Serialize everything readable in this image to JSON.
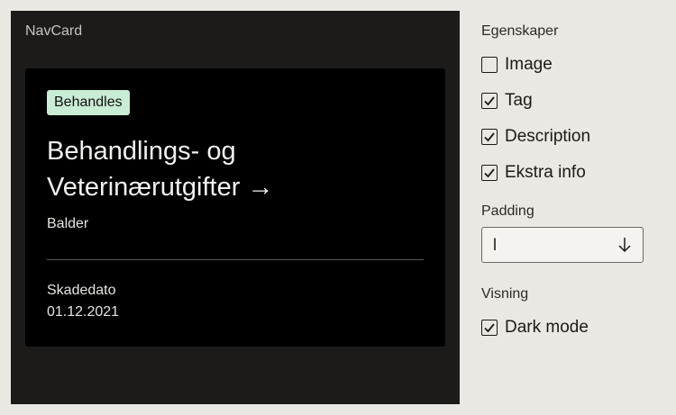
{
  "preview": {
    "label": "NavCard",
    "card": {
      "tag": "Behandles",
      "title_line1": "Behandlings- og",
      "title_line2": "Veterinærutgifter →",
      "description": "Balder",
      "extra_label": "Skadedato",
      "extra_value": "01.12.2021"
    }
  },
  "panel": {
    "properties_title": "Egenskaper",
    "checkboxes": [
      {
        "label": "Image",
        "checked": false
      },
      {
        "label": "Tag",
        "checked": true
      },
      {
        "label": "Description",
        "checked": true
      },
      {
        "label": "Ekstra info",
        "checked": true
      }
    ],
    "padding_title": "Padding",
    "padding_select": {
      "value": "l",
      "icon": "arrow-down-icon"
    },
    "view_title": "Visning",
    "dark_mode": {
      "label": "Dark mode",
      "checked": true
    }
  },
  "colors": {
    "page_bg": "#ebe8e3",
    "preview_bg": "#1c1b1a",
    "card_bg": "#000000",
    "tag_bg": "#c9ecd4"
  }
}
